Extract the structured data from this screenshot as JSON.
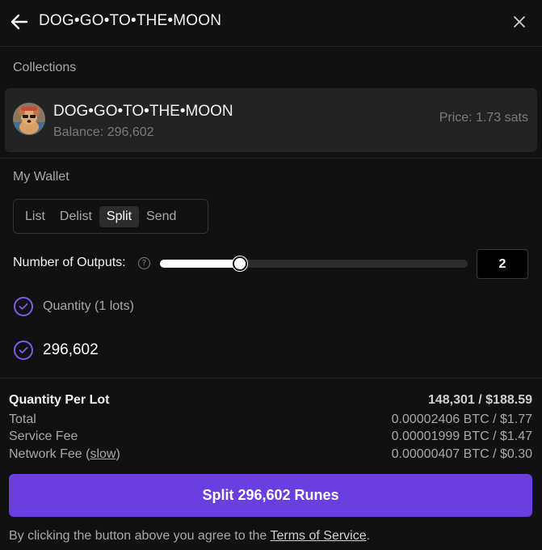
{
  "header": {
    "title": "DOG•GO•TO•THE•MOON",
    "back_icon": "arrow-left-icon",
    "close_icon": "close-icon"
  },
  "collections": {
    "label": "Collections",
    "card": {
      "name": "DOG•GO•TO•THE•MOON",
      "balance": "Balance: 296,602",
      "price": "Price: 1.73 sats"
    }
  },
  "wallet": {
    "label": "My Wallet",
    "tabs": [
      {
        "label": "List",
        "active": false
      },
      {
        "label": "Delist",
        "active": false
      },
      {
        "label": "Split",
        "active": true
      },
      {
        "label": "Send",
        "active": false
      }
    ]
  },
  "outputs": {
    "label": "Number of Outputs:",
    "value": "2",
    "slider_fraction": 0.26
  },
  "checks": {
    "quantity_label": "Quantity (1 lots)",
    "amount": "296,602"
  },
  "summary": {
    "per_lot_label": "Quantity Per Lot",
    "per_lot_value": "148,301 / $188.59",
    "total_label": "Total",
    "total_value": "0.00002406 BTC / $1.77",
    "service_label": "Service Fee",
    "service_value": "0.00001999 BTC / $1.47",
    "network_label_prefix": "Network Fee (",
    "network_speed": "slow",
    "network_label_suffix": ")",
    "network_value": "0.00000407 BTC / $0.30"
  },
  "action": {
    "button_label": "Split 296,602 Runes"
  },
  "footer": {
    "text_prefix": "By clicking the button above you agree to the ",
    "tos_link": "Terms of Service",
    "text_suffix": "."
  },
  "colors": {
    "accent": "#6a3ee0",
    "check": "#7c5cf0",
    "background": "#111111",
    "card": "#232323"
  }
}
